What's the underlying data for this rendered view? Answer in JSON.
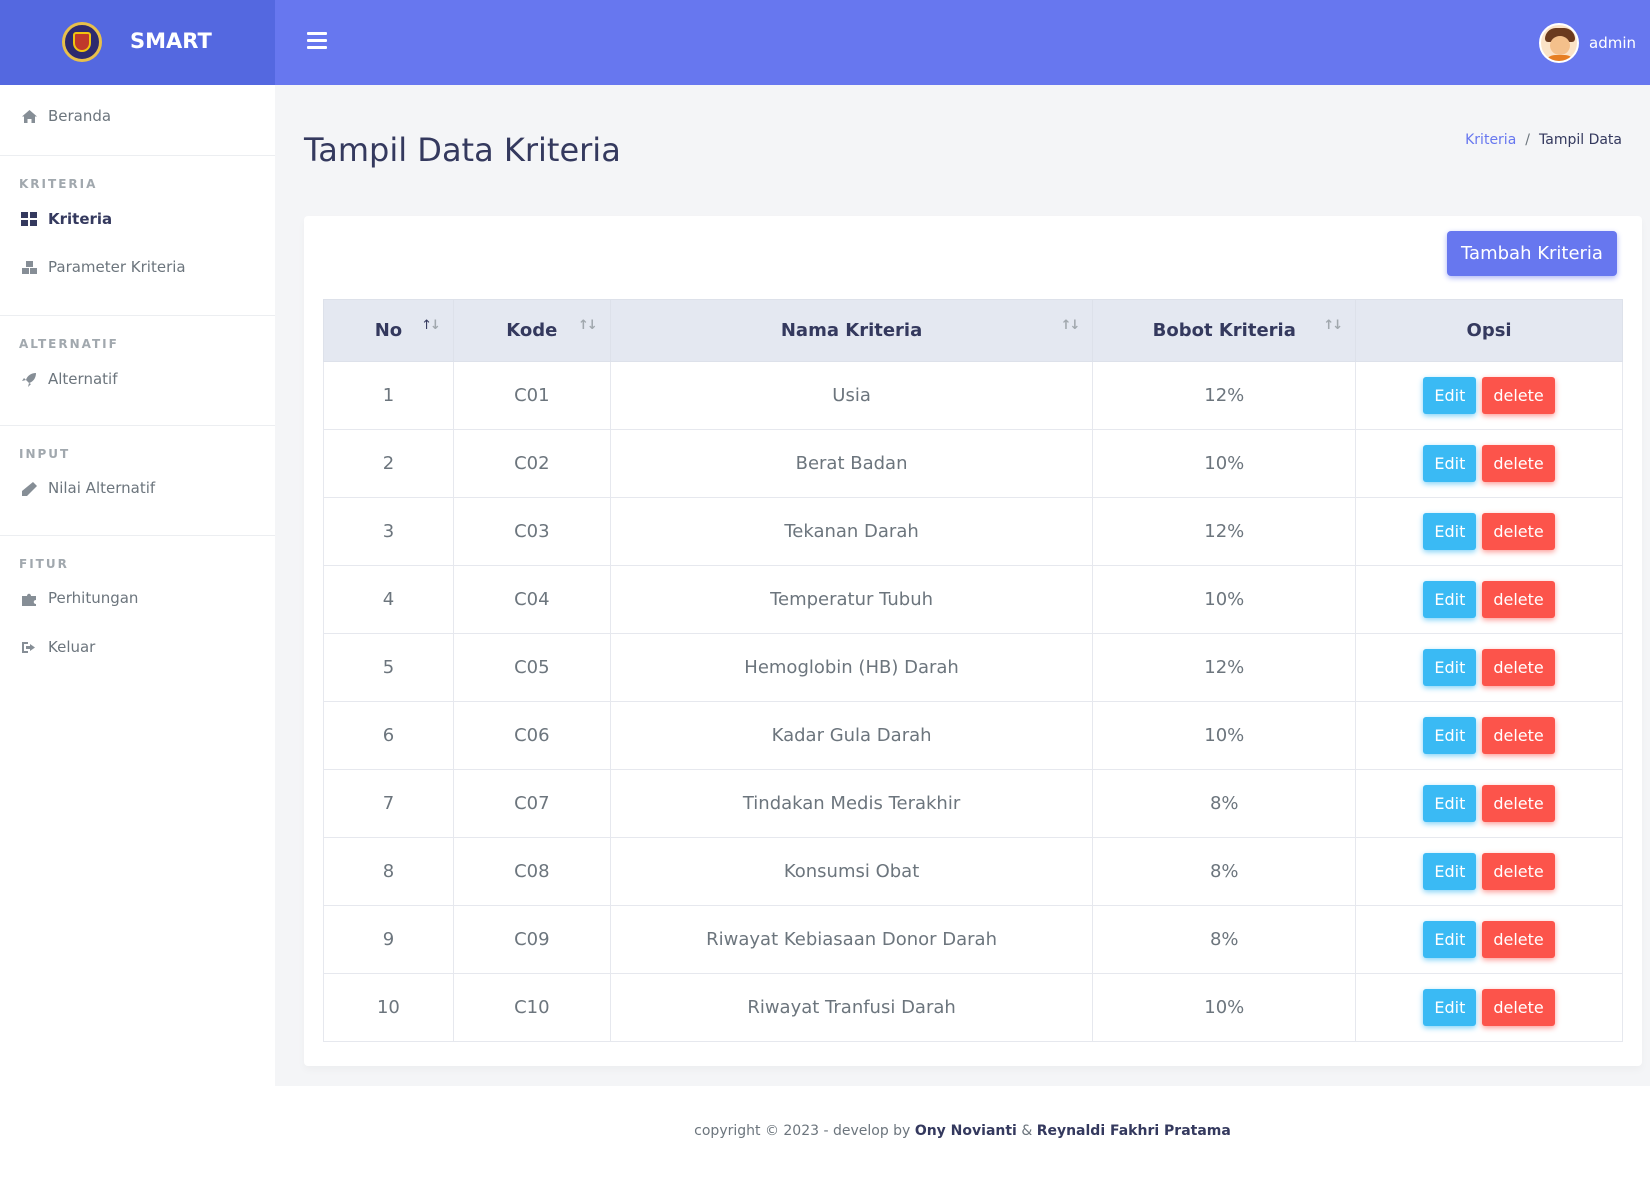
{
  "brand": {
    "name": "SMART"
  },
  "header": {
    "user_name": "admin"
  },
  "sidebar": {
    "home": "Beranda",
    "sections": [
      {
        "header": "KRITERIA",
        "items": [
          "Kriteria",
          "Parameter Kriteria"
        ]
      },
      {
        "header": "ALTERNATIF",
        "items": [
          "Alternatif"
        ]
      },
      {
        "header": "INPUT",
        "items": [
          "Nilai Alternatif"
        ]
      },
      {
        "header": "FITUR",
        "items": [
          "Perhitungan",
          "Keluar"
        ]
      }
    ],
    "active": "Kriteria"
  },
  "page": {
    "title": "Tampil Data Kriteria",
    "breadcrumb": {
      "parent": "Kriteria",
      "separator": "/",
      "current": "Tampil Data"
    }
  },
  "toolbar": {
    "add_label": "Tambah Kriteria"
  },
  "table": {
    "columns": [
      "No",
      "Kode",
      "Nama Kriteria",
      "Bobot Kriteria",
      "Opsi"
    ],
    "rows": [
      {
        "no": "1",
        "kode": "C01",
        "nama": "Usia",
        "bobot": "12%"
      },
      {
        "no": "2",
        "kode": "C02",
        "nama": "Berat Badan",
        "bobot": "10%"
      },
      {
        "no": "3",
        "kode": "C03",
        "nama": "Tekanan Darah",
        "bobot": "12%"
      },
      {
        "no": "4",
        "kode": "C04",
        "nama": "Temperatur Tubuh",
        "bobot": "10%"
      },
      {
        "no": "5",
        "kode": "C05",
        "nama": "Hemoglobin (HB) Darah",
        "bobot": "12%"
      },
      {
        "no": "6",
        "kode": "C06",
        "nama": "Kadar Gula Darah",
        "bobot": "10%"
      },
      {
        "no": "7",
        "kode": "C07",
        "nama": "Tindakan Medis Terakhir",
        "bobot": "8%"
      },
      {
        "no": "8",
        "kode": "C08",
        "nama": "Konsumsi Obat",
        "bobot": "8%"
      },
      {
        "no": "9",
        "kode": "C09",
        "nama": "Riwayat Kebiasaan Donor Darah",
        "bobot": "8%"
      },
      {
        "no": "10",
        "kode": "C10",
        "nama": "Riwayat Tranfusi Darah",
        "bobot": "10%"
      }
    ],
    "edit_label": "Edit",
    "delete_label": "delete"
  },
  "footer": {
    "prefix": "copyright © 2023 - develop by",
    "author1": "Ony Novianti",
    "amp": "&",
    "author2": "Reynaldi Fakhri Pratama"
  },
  "colors": {
    "primary": "#6777ef",
    "info": "#3abaf4",
    "danger": "#fc544b"
  },
  "icons": {
    "home": "home-icon",
    "kriteria": "grid-icon",
    "parameter": "cubes-icon",
    "alternatif": "rocket-icon",
    "nilai": "pencil-icon",
    "perhitungan": "puzzle-icon",
    "keluar": "sign-out-icon"
  }
}
